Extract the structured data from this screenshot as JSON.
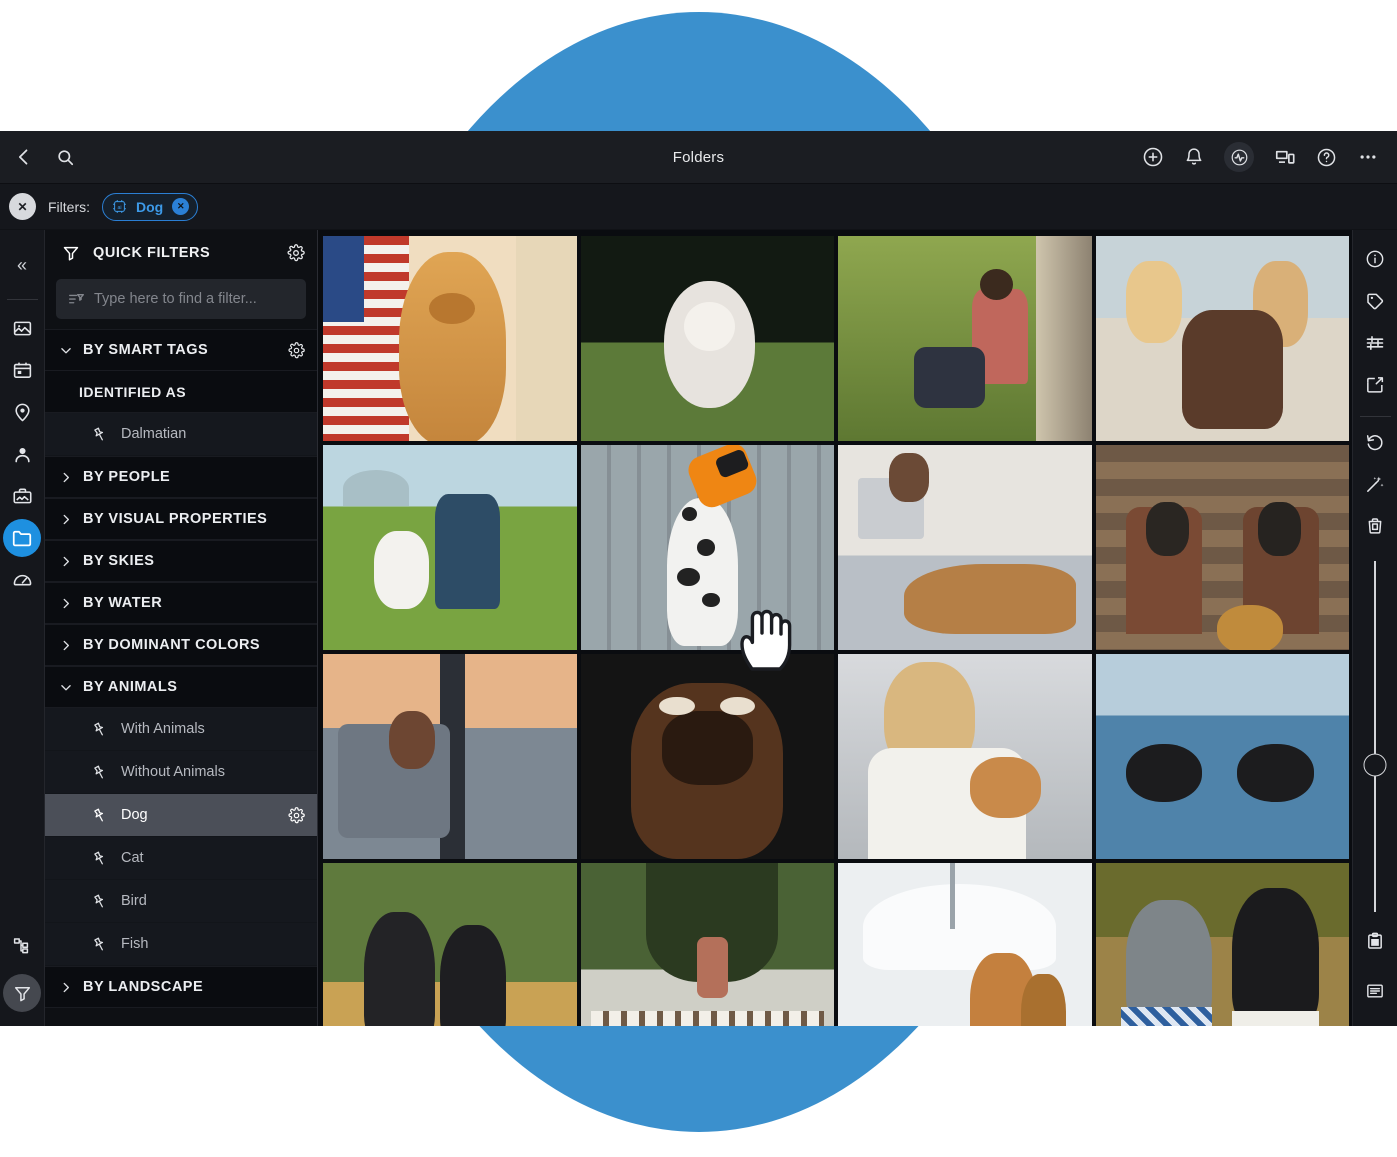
{
  "window": {
    "title": "Folders",
    "back_icon": "back-arrow-icon",
    "search_icon": "search-icon",
    "right_icons": [
      {
        "name": "add-circle-icon",
        "label": "Add"
      },
      {
        "name": "bell-icon",
        "label": "Notifications"
      },
      {
        "name": "activity-pulse-icon",
        "label": "Activity"
      },
      {
        "name": "devices-sync-icon",
        "label": "Devices"
      },
      {
        "name": "help-circle-icon",
        "label": "Help"
      },
      {
        "name": "more-dots-icon",
        "label": "More"
      }
    ]
  },
  "filterbar": {
    "clear_label": "✕",
    "label": "Filters:",
    "chips": [
      {
        "ai_badge": "AI",
        "label": "Dog",
        "remove_label": "✕"
      }
    ]
  },
  "left_rail": {
    "collapse_label": "«",
    "items": [
      {
        "name": "rail-item-photos",
        "icon": "image-icon"
      },
      {
        "name": "rail-item-calendar",
        "icon": "calendar-icon"
      },
      {
        "name": "rail-item-places",
        "icon": "location-pin-icon"
      },
      {
        "name": "rail-item-people",
        "icon": "person-icon"
      },
      {
        "name": "rail-item-albums",
        "icon": "album-briefcase-icon"
      },
      {
        "name": "rail-item-folders",
        "icon": "folder-icon",
        "active": true
      },
      {
        "name": "rail-item-dashboard",
        "icon": "speedometer-icon"
      }
    ],
    "bottom_items": [
      {
        "name": "rail-item-sitemap",
        "icon": "sitemap-icon"
      },
      {
        "name": "rail-item-filter",
        "icon": "funnel-icon",
        "highlighted": true
      }
    ]
  },
  "sidebar": {
    "header": {
      "title": "QUICK FILTERS",
      "funnel_icon": "funnel-icon",
      "gear_icon": "gear-icon"
    },
    "search": {
      "value": "",
      "placeholder": "Type here to find a filter...",
      "icon": "filter-list-icon"
    },
    "tree": [
      {
        "type": "group",
        "label": "BY SMART TAGS",
        "expanded": true,
        "gear": true
      },
      {
        "type": "subhead",
        "label": "IDENTIFIED AS"
      },
      {
        "type": "leaf",
        "label": "Dalmatian",
        "selected": false,
        "gear": false
      },
      {
        "type": "group",
        "label": "BY PEOPLE",
        "expanded": false,
        "gear": false
      },
      {
        "type": "group",
        "label": "BY VISUAL PROPERTIES",
        "expanded": false,
        "gear": false
      },
      {
        "type": "group",
        "label": "BY SKIES",
        "expanded": false,
        "gear": false
      },
      {
        "type": "group",
        "label": "BY WATER",
        "expanded": false,
        "gear": false
      },
      {
        "type": "group",
        "label": "BY DOMINANT COLORS",
        "expanded": false,
        "gear": false
      },
      {
        "type": "group",
        "label": "BY ANIMALS",
        "expanded": true,
        "gear": false
      },
      {
        "type": "leaf",
        "label": "With Animals",
        "selected": false,
        "gear": false
      },
      {
        "type": "leaf",
        "label": "Without Animals",
        "selected": false,
        "gear": false
      },
      {
        "type": "leaf",
        "label": "Dog",
        "selected": true,
        "gear": true
      },
      {
        "type": "leaf",
        "label": "Cat",
        "selected": false,
        "gear": false
      },
      {
        "type": "leaf",
        "label": "Bird",
        "selected": false,
        "gear": false
      },
      {
        "type": "leaf",
        "label": "Fish",
        "selected": false,
        "gear": false
      },
      {
        "type": "group",
        "label": "BY LANDSCAPE",
        "expanded": false,
        "gear": false
      }
    ]
  },
  "grid": {
    "columns": 4,
    "tiles": [
      {
        "id": 1,
        "alt": "Golden retriever in front of American flag",
        "selected": false
      },
      {
        "id": 2,
        "alt": "White fluffy dog running on grass",
        "selected": false
      },
      {
        "id": 3,
        "alt": "Man sitting in tall grass with dog",
        "selected": false
      },
      {
        "id": 4,
        "alt": "Two women at the beach petting a brown boxer",
        "selected": false
      },
      {
        "id": 5,
        "alt": "Man kneeling on lawn with small white dog",
        "selected": false
      },
      {
        "id": 6,
        "alt": "Dalmatian statue with orange car on its nose",
        "selected": true
      },
      {
        "id": 7,
        "alt": "Woman on bed with laptop and sleeping retriever",
        "selected": false
      },
      {
        "id": 8,
        "alt": "Couple sitting in office chairs with dog",
        "selected": false
      },
      {
        "id": 9,
        "alt": "Woman on couch hugging a dog by a window",
        "selected": false
      },
      {
        "id": 10,
        "alt": "German shepherd face close up with person behind",
        "selected": false
      },
      {
        "id": 11,
        "alt": "Woman in white sweater holding a chihuahua",
        "selected": false
      },
      {
        "id": 12,
        "alt": "Two black dogs swimming in water",
        "selected": false
      },
      {
        "id": 13,
        "alt": "Two black shepherd dogs in a field",
        "selected": false
      },
      {
        "id": 14,
        "alt": "Hunt pack of hounds on a country lane with riders",
        "selected": false
      },
      {
        "id": 15,
        "alt": "Two golden retrievers in front of a white yacht",
        "selected": false
      },
      {
        "id": 16,
        "alt": "Two dogs wearing bandanas in autumn woods",
        "selected": false
      }
    ]
  },
  "right_rail": {
    "top_items": [
      {
        "name": "info-icon"
      },
      {
        "name": "tag-icon"
      },
      {
        "name": "adjustments-sliders-icon"
      },
      {
        "name": "export-icon"
      }
    ],
    "mid_items": [
      {
        "name": "history-rotate-icon"
      },
      {
        "name": "magic-wand-icon"
      },
      {
        "name": "trash-icon"
      }
    ],
    "slider": {
      "name": "zoom-slider",
      "value": 58
    },
    "bottom_items": [
      {
        "name": "clipboard-icon"
      },
      {
        "name": "details-list-icon"
      }
    ]
  },
  "cursor": {
    "name": "pointing-hand-cursor"
  },
  "colors": {
    "accent_blue": "#3b90cd",
    "selection_blue": "#2d93e0",
    "chip_blue": "#3d9ae8",
    "panel_bg": "#0e1014",
    "window_bg": "#15171c"
  }
}
